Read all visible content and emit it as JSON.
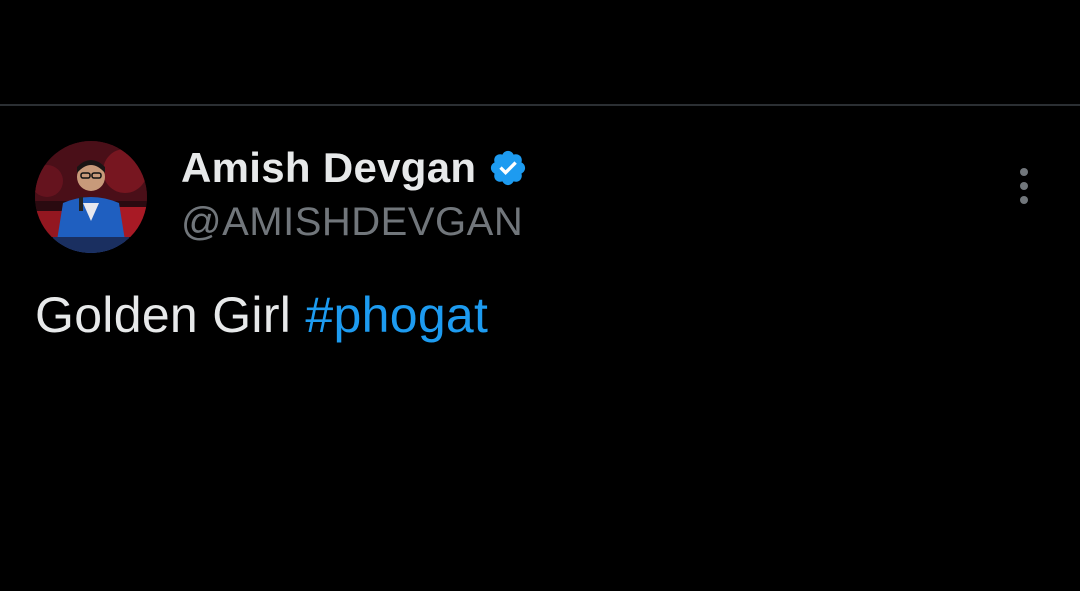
{
  "tweet": {
    "author": {
      "display_name": "Amish Devgan",
      "handle": "@AMISHDEVGAN",
      "verified": true,
      "verified_color": "#1d9bf0"
    },
    "text": "Golden Girl",
    "hashtag": "#phogat",
    "colors": {
      "background": "#000000",
      "primary_text": "#e7e9ea",
      "secondary_text": "#71767b",
      "link": "#1d9bf0"
    }
  },
  "icons": {
    "verified": "verified-badge-icon",
    "more": "more-options-icon"
  }
}
